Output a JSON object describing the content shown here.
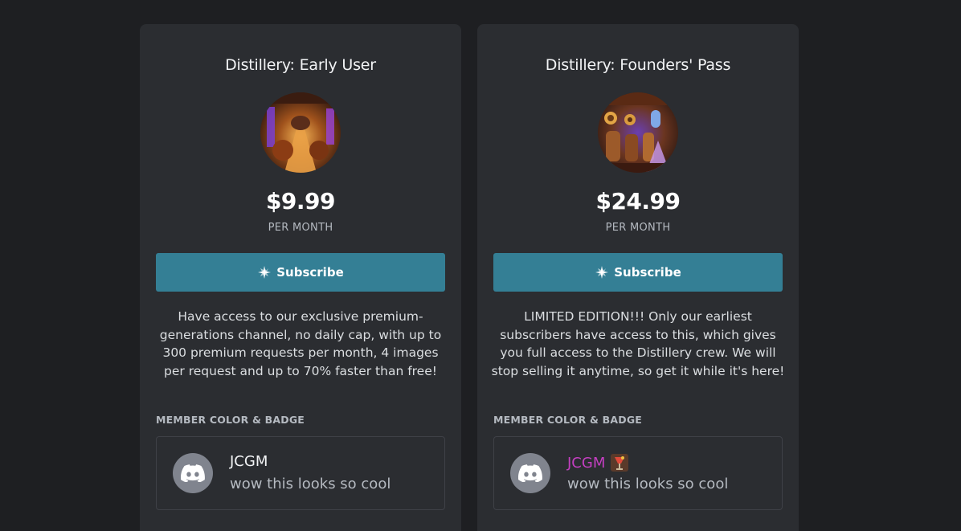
{
  "colors": {
    "background": "#1e1f22",
    "card": "#2b2d31",
    "subscribe_button": "#347f95",
    "member_color_tier2": "#c43fc1"
  },
  "tiers": [
    {
      "title": "Distillery: Early User",
      "price": "$9.99",
      "period": "PER MONTH",
      "subscribe_label": "Subscribe",
      "description": "Have access to our exclusive premium-generations channel, no daily cap, with up to 300 premium requests per month, 4 images per request and up to 70% faster than free!",
      "section_label": "MEMBER COLOR & BADGE",
      "preview": {
        "username": "JCGM",
        "message": "wow this looks so cool",
        "avatar_icon": "discord-icon"
      }
    },
    {
      "title": "Distillery: Founders' Pass",
      "price": "$24.99",
      "period": "PER MONTH",
      "subscribe_label": "Subscribe",
      "description": "LIMITED EDITION!!! Only our earliest subscribers have access to this, which gives you full access to the Distillery crew. We will stop selling it anytime, so get it while it's here!",
      "section_label": "MEMBER COLOR & BADGE",
      "preview": {
        "username": "JCGM",
        "message": "wow this looks so cool",
        "avatar_icon": "discord-icon",
        "badge_icon": "cocktail-badge-icon"
      }
    }
  ]
}
